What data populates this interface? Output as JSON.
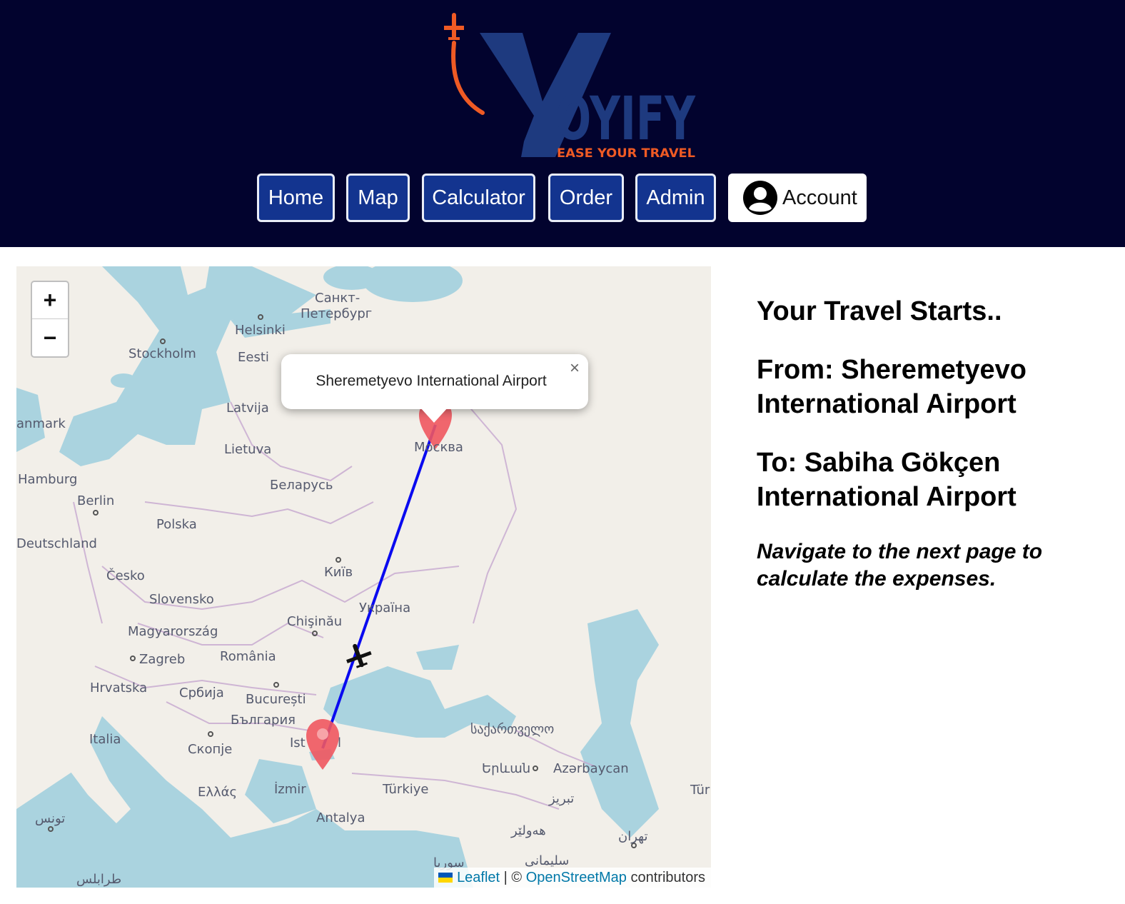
{
  "brand": {
    "name": "OYIFY",
    "tagline": "EASE YOUR TRAVEL",
    "colors": {
      "header_bg": "#02032e",
      "logo_blue": "#1e3a7f",
      "logo_orange": "#ef5a24",
      "nav_bg": "#13348f"
    }
  },
  "nav": {
    "items": [
      "Home",
      "Map",
      "Calculator",
      "Order",
      "Admin"
    ],
    "account_label": "Account",
    "account_icon": "user-avatar-icon"
  },
  "map": {
    "zoom_in": "+",
    "zoom_out": "−",
    "popup": {
      "text": "Sheremetyevo International Airport",
      "close": "×"
    },
    "attribution": {
      "leaflet": "Leaflet",
      "separator": " | © ",
      "osm": "OpenStreetMap",
      "suffix": " contributors"
    },
    "route_color": "#0a0af0",
    "marker_color": "#f0575f",
    "labels": [
      "Санкт-",
      "Петербург",
      "Helsinki",
      "Stockholm",
      "Eesti",
      "Latvija",
      "anmark",
      "Lietuva",
      "Москва",
      "Hamburg",
      "Berlin",
      "Беларусь",
      "Polska",
      "Deutschland",
      "Česko",
      "Київ",
      "Slovensko",
      "Україна",
      "Chişinău",
      "Magyarország",
      "Zagreb",
      "România",
      "Hrvatska",
      "Србија",
      "București",
      "България",
      "Italia",
      "Скопје",
      "Ist",
      "l",
      "საქართველო",
      "Երևան",
      "Azərbaycan",
      "Ελλάς",
      "İzmir",
      "Türkiye",
      "Antalya",
      "تونس",
      "تبریز",
      "Tür",
      "هەولێر",
      "تهران",
      "سوريا",
      "سليمانی",
      "طرابلس"
    ]
  },
  "info": {
    "title": "Your Travel Starts..",
    "from": "From: Sheremetyevo International Airport",
    "to": "To: Sabiha Gökçen International Airport",
    "hint": "Navigate to the next page to calculate the expenses."
  }
}
